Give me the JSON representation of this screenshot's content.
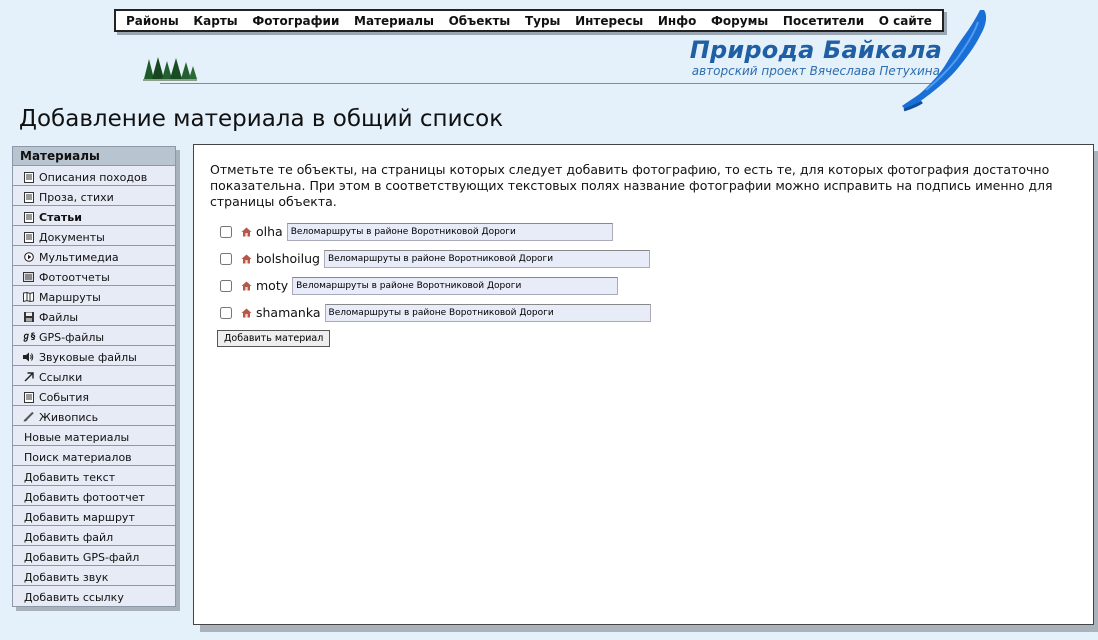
{
  "nav": [
    "Районы",
    "Карты",
    "Фотографии",
    "Материалы",
    "Объекты",
    "Туры",
    "Интересы",
    "Инфо",
    "Форумы",
    "Посетители",
    "О сайте"
  ],
  "site": {
    "title": "Природа Байкала",
    "subtitle": "авторский проект Вячеслава Петухина"
  },
  "page_title": "Добавление материала в общий список",
  "sidebar": {
    "header": "Материалы",
    "items": [
      {
        "label": "Описания походов",
        "icon": "doc-icon"
      },
      {
        "label": "Проза, стихи",
        "icon": "doc-icon"
      },
      {
        "label": "Статьи",
        "icon": "doc-icon",
        "active": true
      },
      {
        "label": "Документы",
        "icon": "doc-icon"
      },
      {
        "label": "Мультимедиа",
        "icon": "play-icon"
      },
      {
        "label": "Фотоотчеты",
        "icon": "photo-icon"
      },
      {
        "label": "Маршруты",
        "icon": "route-icon"
      },
      {
        "label": "Файлы",
        "icon": "floppy-icon"
      },
      {
        "label": "GPS-файлы",
        "icon": "gps-icon"
      },
      {
        "label": "Звуковые файлы",
        "icon": "speaker-icon"
      },
      {
        "label": "Ссылки",
        "icon": "arrow-icon"
      },
      {
        "label": "События",
        "icon": "doc-icon"
      },
      {
        "label": "Живопись",
        "icon": "brush-icon"
      },
      {
        "label": "Новые материалы"
      },
      {
        "label": "Поиск материалов"
      },
      {
        "label": "Добавить текст"
      },
      {
        "label": "Добавить фотоотчет"
      },
      {
        "label": "Добавить маршрут"
      },
      {
        "label": "Добавить файл"
      },
      {
        "label": "Добавить GPS-файл"
      },
      {
        "label": "Добавить звук"
      },
      {
        "label": "Добавить ссылку"
      }
    ]
  },
  "content": {
    "intro": "Отметьте те объекты, на страницы которых следует добавить фотографию, то есть те, для которых фотография достаточно показательна. При этом в соответствующих текстовых полях название фотографии можно исправить на подпись именно для страницы объекта.",
    "objects": [
      {
        "name": "olha",
        "value": "Веломаршруты в районе Воротниковой Дороги",
        "checked": false
      },
      {
        "name": "bolshoilug",
        "value": "Веломаршруты в районе Воротниковой Дороги",
        "checked": false
      },
      {
        "name": "moty",
        "value": "Веломаршруты в районе Воротниковой Дороги",
        "checked": false
      },
      {
        "name": "shamanka",
        "value": "Веломаршруты в районе Воротниковой Дороги",
        "checked": false
      }
    ],
    "submit_label": "Добавить материал"
  },
  "colors": {
    "background": "#e4f0fa",
    "title_blue": "#1f5fa4",
    "sidebar_bg": "#e6ebf5",
    "sidebar_head": "#b8c4d0",
    "home_icon": "#b5574a"
  }
}
